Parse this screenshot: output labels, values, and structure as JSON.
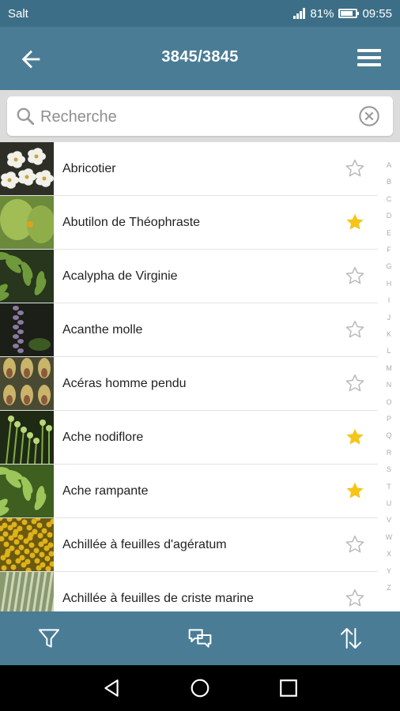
{
  "status": {
    "carrier": "Salt",
    "battery": "81%",
    "battery_level": 0.81,
    "time": "09:55"
  },
  "appbar": {
    "title": "3845/3845",
    "back_icon": "arrow-left-icon",
    "menu_icon": "hamburger-menu-icon"
  },
  "search": {
    "placeholder": "Recherche",
    "value": ""
  },
  "plants": [
    {
      "name": "Abricotier",
      "favorite": false,
      "thumb": {
        "bg": "#2d2f26",
        "fg": "#f1f0ea",
        "shape": "flower"
      }
    },
    {
      "name": "Abutilon de Théophraste",
      "favorite": true,
      "thumb": {
        "bg": "#6b8a3b",
        "fg": "#a7c25a",
        "shape": "leaf"
      }
    },
    {
      "name": "Acalypha de Virginie",
      "favorite": false,
      "thumb": {
        "bg": "#27361d",
        "fg": "#6f9a3c",
        "shape": "leaves"
      }
    },
    {
      "name": "Acanthe molle",
      "favorite": false,
      "thumb": {
        "bg": "#1b1f18",
        "fg": "#8a7aa0",
        "shape": "spike"
      }
    },
    {
      "name": "Acéras homme pendu",
      "favorite": false,
      "thumb": {
        "bg": "#4a4a33",
        "fg": "#c9b46a",
        "shape": "orchid"
      }
    },
    {
      "name": "Ache nodiflore",
      "favorite": true,
      "thumb": {
        "bg": "#1f2a14",
        "fg": "#7fae45",
        "shape": "stems"
      }
    },
    {
      "name": "Ache rampante",
      "favorite": true,
      "thumb": {
        "bg": "#3e5f20",
        "fg": "#9cc65a",
        "shape": "leaves"
      }
    },
    {
      "name": "Achillée à feuilles d'agératum",
      "favorite": false,
      "thumb": {
        "bg": "#6a5a10",
        "fg": "#e0b21a",
        "shape": "dots"
      }
    },
    {
      "name": "Achillée à feuilles de criste marine",
      "favorite": false,
      "thumb": {
        "bg": "#8a9a70",
        "fg": "#cfd6b8",
        "shape": "grass"
      }
    }
  ],
  "alphabet": [
    "A",
    "B",
    "C",
    "D",
    "E",
    "F",
    "G",
    "H",
    "I",
    "J",
    "K",
    "L",
    "M",
    "N",
    "O",
    "P",
    "Q",
    "R",
    "S",
    "T",
    "U",
    "V",
    "W",
    "X",
    "Y",
    "Z"
  ],
  "colors": {
    "appbar": "#4a7d95",
    "statusbar": "#3c6f87",
    "star_on": "#f5c518",
    "star_off": "#b9b9b9"
  },
  "bottom_bar": {
    "filter_icon": "filter-icon",
    "chat_icon": "chat-bubbles-icon",
    "sort_icon": "sort-arrows-icon"
  },
  "nav": {
    "back_icon": "nav-back-icon",
    "home_icon": "nav-home-icon",
    "recents_icon": "nav-recents-icon"
  }
}
